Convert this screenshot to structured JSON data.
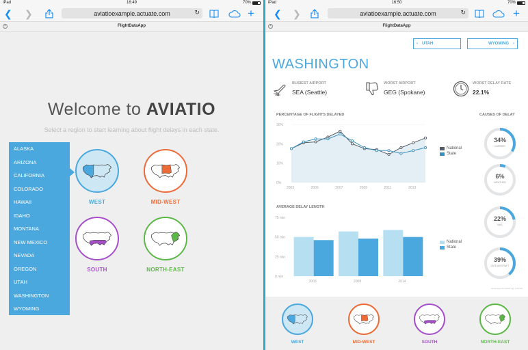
{
  "left": {
    "status": {
      "carrier": "iPad",
      "time": "16:49",
      "battery": "70%"
    },
    "url": "aviatioexample.actuate.com",
    "tab_title": "FlightDataApp",
    "welcome_prefix": "Welcome to ",
    "welcome_brand": "AVIATIO",
    "subtitle": "Select a region to start learning about flight delays in each state.",
    "states": [
      "ALASKA",
      "ARIZONA",
      "CALIFORNIA",
      "COLORADO",
      "HAWAII",
      "IDAHO",
      "MONTANA",
      "NEW MEXICO",
      "NEVADA",
      "OREGON",
      "UTAH",
      "WASHINGTON",
      "WYOMING"
    ],
    "regions": [
      {
        "label": "WEST",
        "color": "#4aa8de"
      },
      {
        "label": "MID-WEST",
        "color": "#ee6b38"
      },
      {
        "label": "SOUTH",
        "color": "#a64fc9"
      },
      {
        "label": "NORTH-EAST",
        "color": "#5bb847"
      }
    ]
  },
  "right": {
    "status": {
      "carrier": "iPad",
      "time": "16:50",
      "battery": "70%"
    },
    "url": "aviatioexample.actuate.com",
    "tab_title": "FlightDataApp",
    "prev_state": "UTAH",
    "next_state": "WYOMING",
    "state_title": "WASHINGTON",
    "stats": [
      {
        "label": "BUSIEST AIRPORT",
        "code": "SEA",
        "city": "(Seattle)"
      },
      {
        "label": "WORST AIRPORT",
        "code": "GEG",
        "city": "(Spokane)"
      },
      {
        "label": "WORST DELAY RATE",
        "code": "22.1%",
        "city": ""
      }
    ],
    "delayed_title": "PERCENTAGE OF FLIGHTS DELAYED",
    "avg_title": "AVERAGE DELAY LENGTH",
    "causes_title": "CAUSES OF DELAY",
    "causes": [
      {
        "value": "34%",
        "label": "CARRIER",
        "pct": 34
      },
      {
        "value": "6%",
        "label": "WEATHER",
        "pct": 6
      },
      {
        "value": "22%",
        "label": "NAS",
        "pct": 22
      },
      {
        "value": "39%",
        "label": "LATE AIRCRAFT",
        "pct": 39
      }
    ],
    "legend": {
      "national": "National",
      "state": "State"
    },
    "footnote": "Generated 01/12/2014 @ 4:49 PM",
    "colors": {
      "national": "#555b64",
      "state": "#4aa8de",
      "national_bar": "#b6dff2",
      "state_bar": "#4aa8de"
    },
    "regions": [
      {
        "label": "WEST",
        "color": "#4aa8de"
      },
      {
        "label": "MID-WEST",
        "color": "#ee6b38"
      },
      {
        "label": "SOUTH",
        "color": "#a64fc9"
      },
      {
        "label": "NORTH-EAST",
        "color": "#5bb847"
      }
    ]
  },
  "chart_data": [
    {
      "type": "line",
      "title": "PERCENTAGE OF FLIGHTS DELAYED",
      "x": [
        2003,
        2004,
        2005,
        2006,
        2007,
        2008,
        2009,
        2010,
        2011,
        2012,
        2013,
        2014
      ],
      "x_ticks": [
        "2003",
        "2005",
        "2007",
        "2009",
        "2011",
        "2013"
      ],
      "y_ticks": [
        "0%",
        "10%",
        "20%",
        "30%"
      ],
      "ylim": [
        0,
        30
      ],
      "series": [
        {
          "name": "National",
          "values": [
            17.5,
            20.5,
            21,
            23.5,
            26.5,
            20,
            17.5,
            17,
            14.5,
            18,
            20.5,
            23
          ]
        },
        {
          "name": "State",
          "values": [
            17.5,
            21,
            22.5,
            22.5,
            25,
            21.5,
            18,
            16.5,
            16.5,
            15,
            16.5,
            18
          ]
        }
      ]
    },
    {
      "type": "bar",
      "title": "AVERAGE DELAY LENGTH",
      "categories": [
        "2003",
        "2008",
        "2014"
      ],
      "y_ticks": [
        "0 min",
        "25 min",
        "50 min",
        "75 min"
      ],
      "ylim": [
        0,
        75
      ],
      "series": [
        {
          "name": "National",
          "values": [
            50,
            57,
            59
          ]
        },
        {
          "name": "State",
          "values": [
            46,
            48,
            50
          ]
        }
      ]
    }
  ]
}
